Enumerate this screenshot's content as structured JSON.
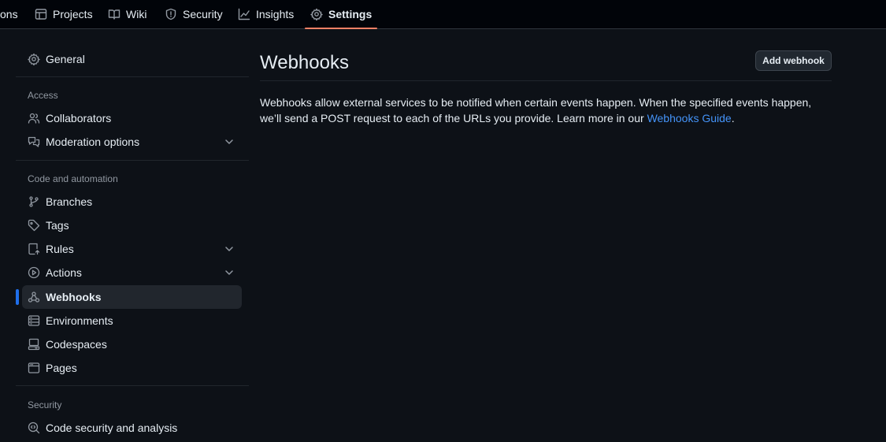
{
  "topnav": {
    "tabs": [
      {
        "label": "ons",
        "icon": "actions-icon"
      },
      {
        "label": "Projects",
        "icon": "table-icon"
      },
      {
        "label": "Wiki",
        "icon": "book-icon"
      },
      {
        "label": "Security",
        "icon": "shield-icon"
      },
      {
        "label": "Insights",
        "icon": "graph-icon"
      },
      {
        "label": "Settings",
        "icon": "gear-icon",
        "selected": true
      }
    ]
  },
  "sidebar": {
    "general": {
      "label": "General",
      "icon": "gear-icon"
    },
    "groups": {
      "access": "Access",
      "code_automation": "Code and automation",
      "security": "Security"
    },
    "items": {
      "collaborators": "Collaborators",
      "moderation": "Moderation options",
      "branches": "Branches",
      "tags": "Tags",
      "rules": "Rules",
      "actions": "Actions",
      "webhooks": "Webhooks",
      "environments": "Environments",
      "codespaces": "Codespaces",
      "pages": "Pages",
      "code_security": "Code security and analysis"
    },
    "active": "webhooks"
  },
  "main": {
    "title": "Webhooks",
    "add_button": "Add webhook",
    "description_before": "Webhooks allow external services to be notified when certain events happen. When the specified events happen, we’ll send a POST request to each of the URLs you provide. Learn more in our ",
    "link_text": "Webhooks Guide",
    "description_after": "."
  },
  "colors": {
    "background": "#0d1117",
    "topnav_bg": "#010409",
    "accent_underline": "#f78166",
    "active_marker": "#1f6feb",
    "link": "#4493f8"
  }
}
